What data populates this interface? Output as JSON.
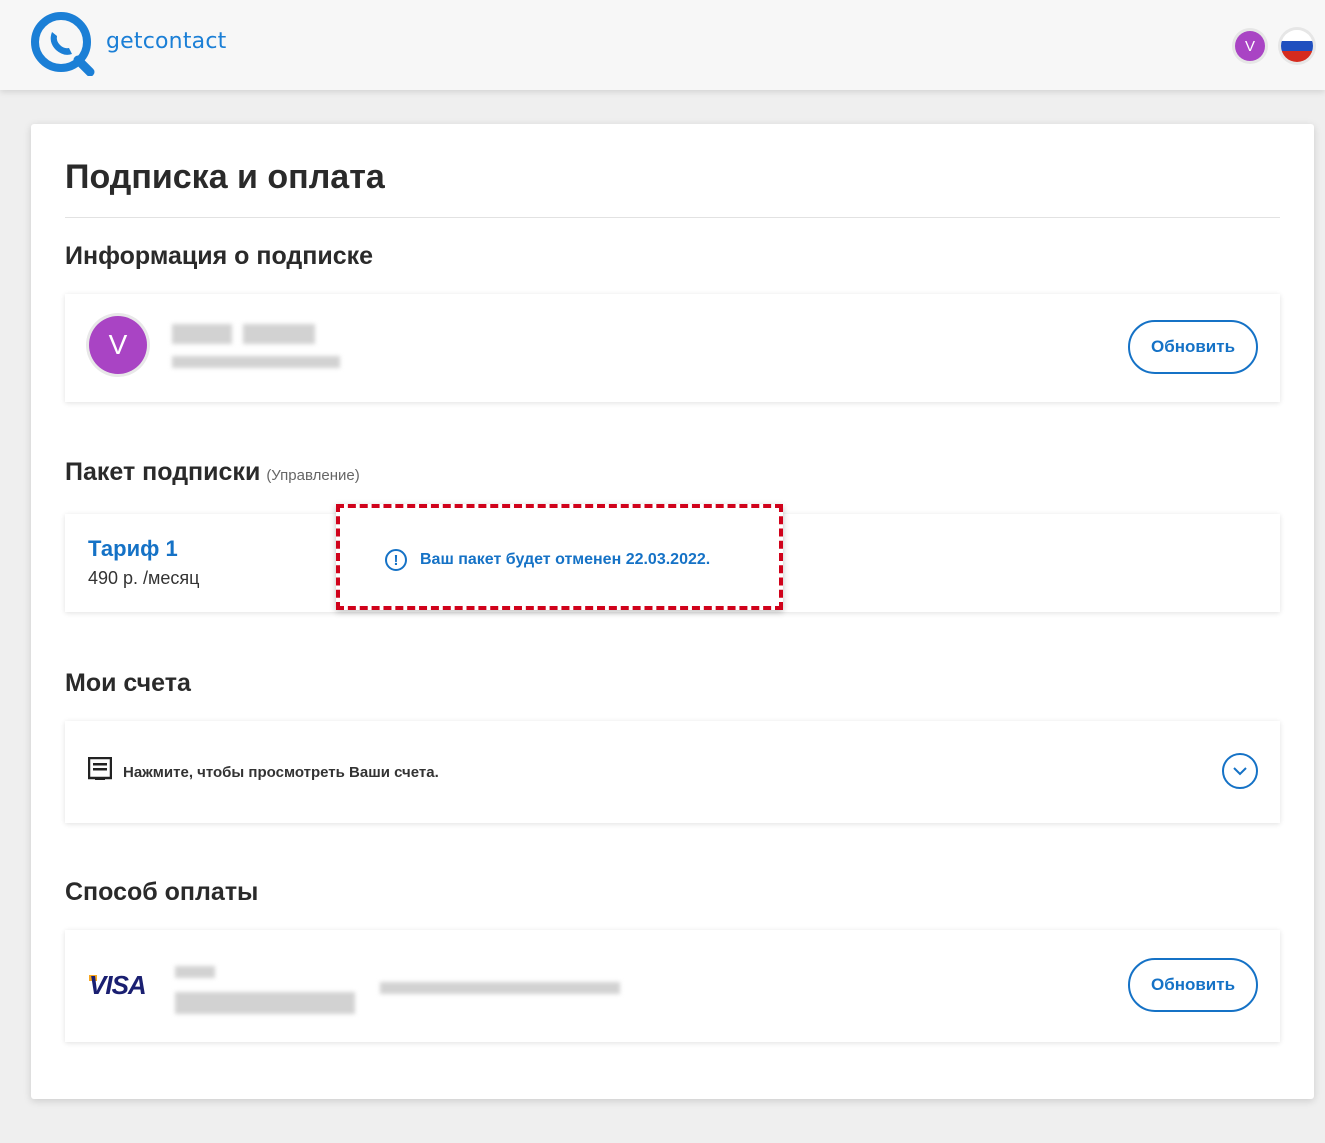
{
  "header": {
    "logo_text": "getcontact",
    "user_initial": "V",
    "language": "ru",
    "brand_color": "#1b7fd6"
  },
  "page": {
    "title": "Подписка и оплата"
  },
  "subscription_info": {
    "title": "Информация о подписке",
    "avatar_initial": "V",
    "update_label": "Обновить"
  },
  "subscription_package": {
    "title": "Пакет подписки",
    "manage_label": "(Управление)",
    "plan_name": "Тариф 1",
    "plan_price": "490 р. /месяц",
    "notice": "Ваш пакет будет отменен 22.03.2022."
  },
  "invoices": {
    "title": "Мои счета",
    "hint": "Нажмите, чтобы просмотреть Ваши счета."
  },
  "payment": {
    "title": "Способ оплаты",
    "card_brand": "VISA",
    "update_label": "Обновить"
  },
  "colors": {
    "accent": "#1572c6",
    "avatar": "#a944c4",
    "highlight_border": "#d0021b"
  }
}
